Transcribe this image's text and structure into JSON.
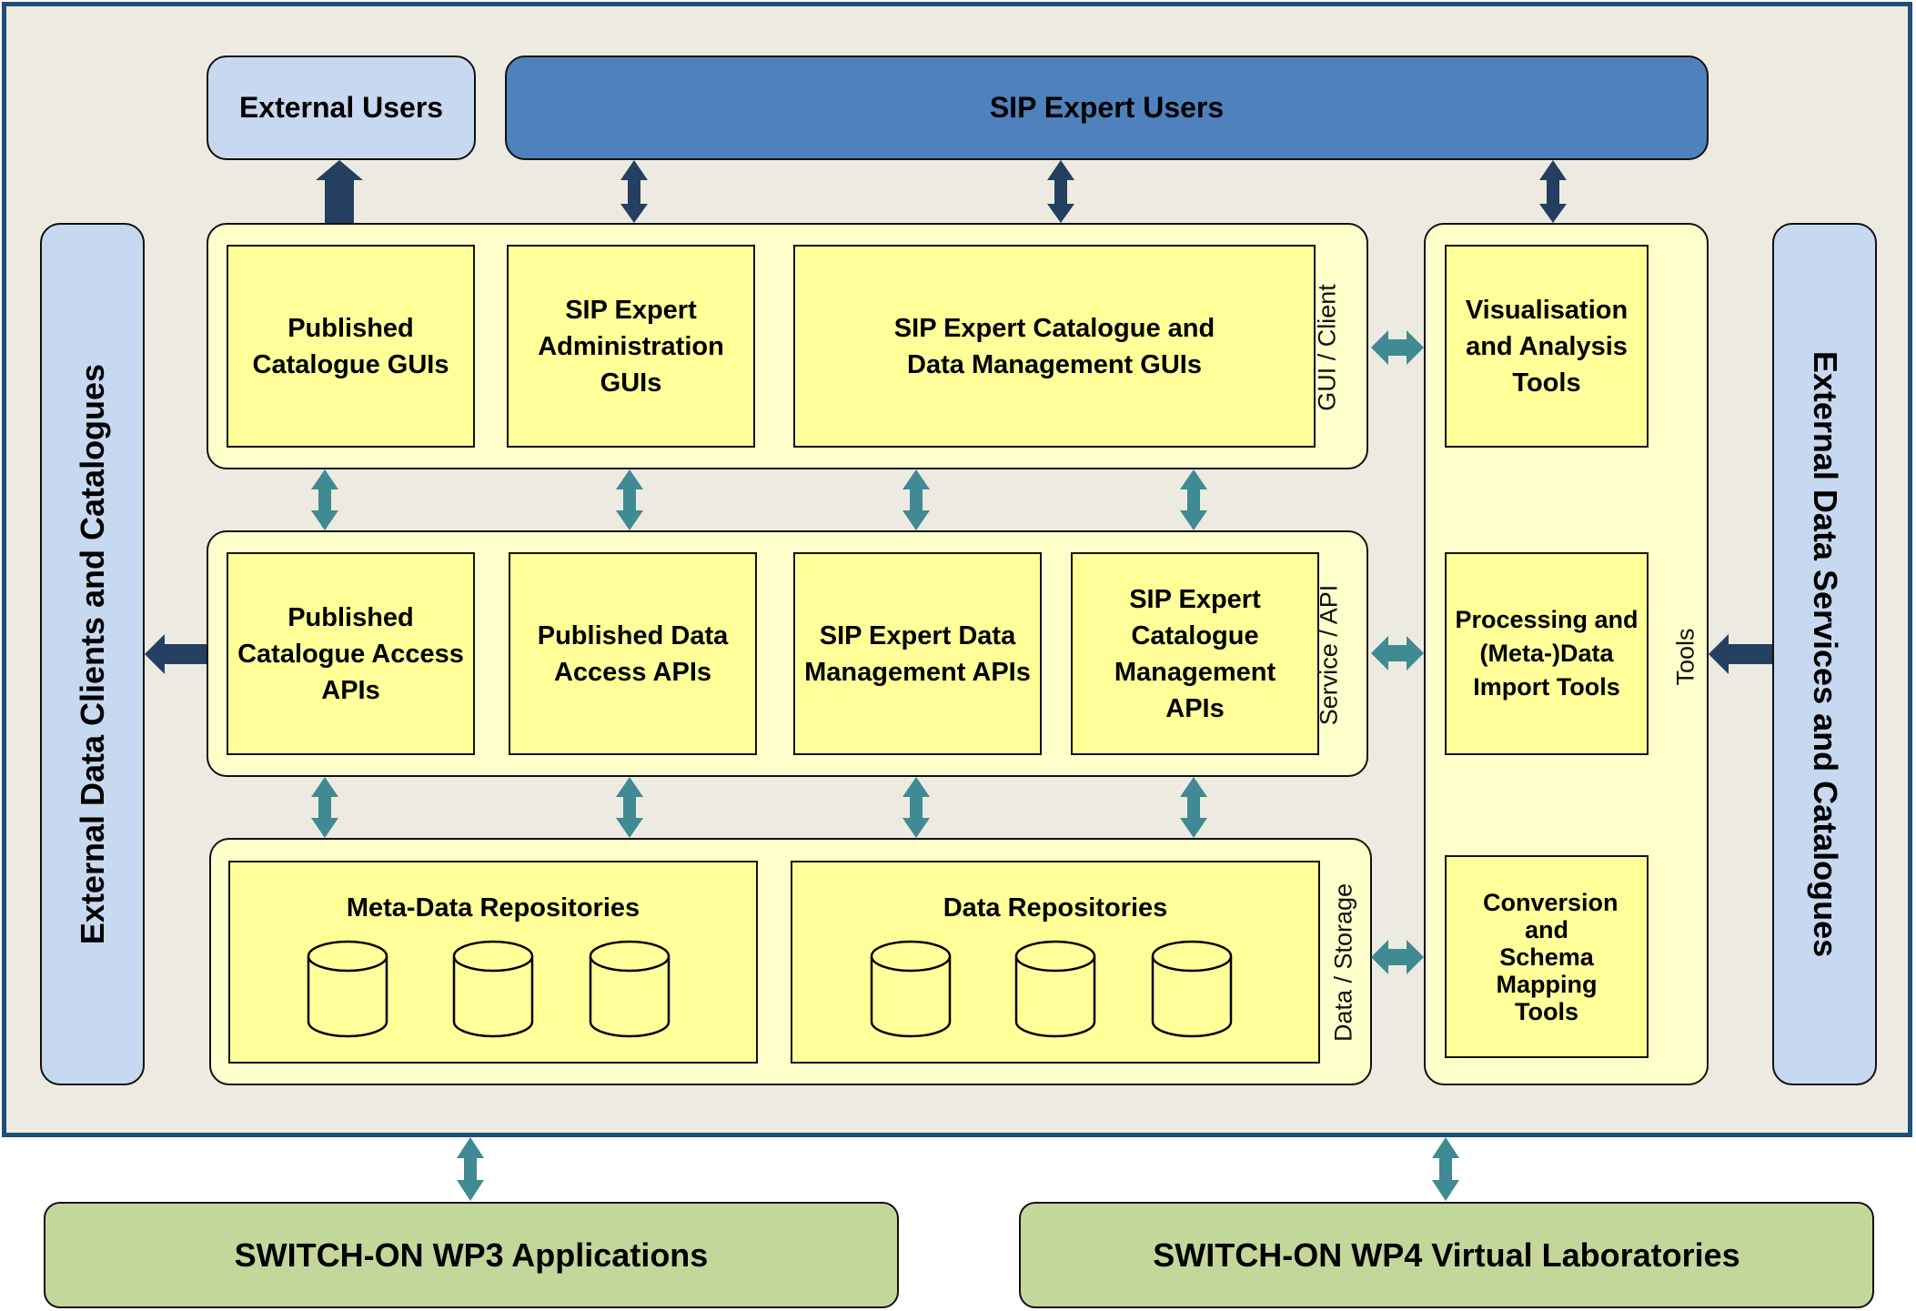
{
  "diagram": {
    "colors": {
      "frame_border": "#1f4e79",
      "frame_bg": "#edebe1",
      "external_light_blue": "#c6d9f0",
      "sip_users_blue": "#4f81bd",
      "layer_bg": "#ffffcc",
      "component_bg": "#ffff99",
      "green_box": "#c4d79b",
      "dark_arrow": "#243f60",
      "teal_arrow": "#3f8a93"
    },
    "top": {
      "external_users": "External Users",
      "sip_expert_users": "SIP Expert Users"
    },
    "left_panel": "External Data Clients and Catalogues",
    "right_panel": "External Data Services and Catalogues",
    "layers": {
      "gui": {
        "label": "GUI / Client",
        "components": [
          "Published Catalogue GUIs",
          "SIP Expert Administration GUIs",
          "SIP Expert Catalogue and Data Management GUIs"
        ]
      },
      "api": {
        "label": "Service / API",
        "components": [
          "Published Catalogue Access APIs",
          "Published Data Access APIs",
          "SIP Expert Data Management APIs",
          "SIP Expert Catalogue Management APIs"
        ]
      },
      "storage": {
        "label": "Data / Storage",
        "repositories": [
          {
            "title": "Meta-Data Repositories",
            "count": 3
          },
          {
            "title": "Data Repositories",
            "count": 3
          }
        ]
      },
      "tools": {
        "label": "Tools",
        "components": [
          "Visualisation and Analysis Tools",
          "Processing and (Meta-)Data Import Tools",
          "Conversion and Schema Mapping Tools"
        ]
      }
    },
    "bottom": {
      "wp3": "SWITCH-ON WP3 Applications",
      "wp4": "SWITCH-ON WP4 Virtual Laboratories"
    }
  }
}
